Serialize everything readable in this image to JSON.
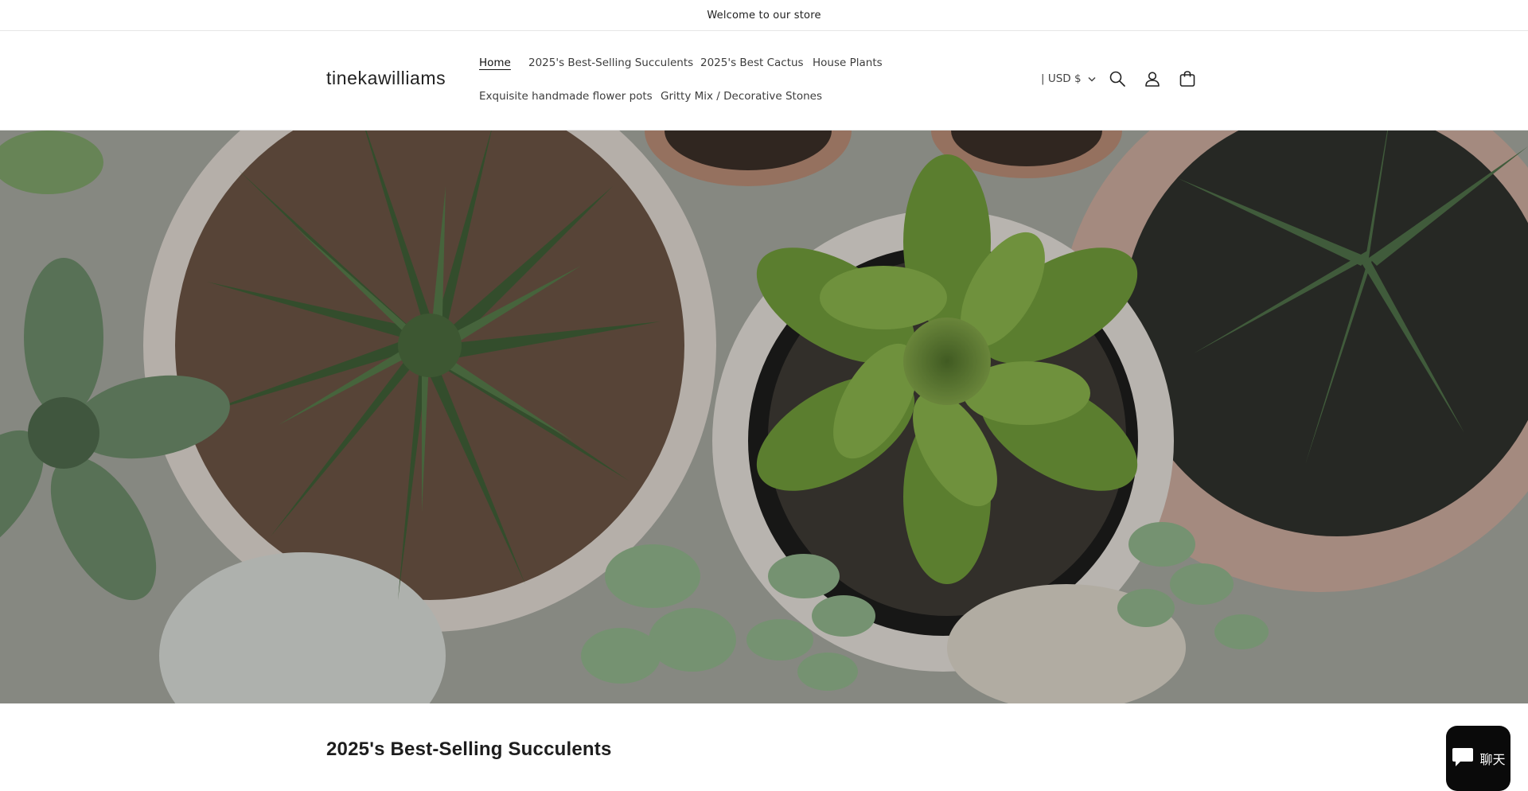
{
  "announcement": {
    "text": "Welcome to our store"
  },
  "header": {
    "logo": "tinekawilliams",
    "nav": [
      {
        "label": "Home",
        "active": true
      },
      {
        "label": "2025's Best-Selling Succulents",
        "active": false
      },
      {
        "label": "2025's Best Cactus",
        "active": false
      },
      {
        "label": "House Plants",
        "active": false
      },
      {
        "label": "Exquisite handmade flower pots",
        "active": false
      },
      {
        "label": "Gritty Mix / Decorative Stones",
        "active": false
      }
    ],
    "currency": "| USD $",
    "icons": [
      "search-icon",
      "account-icon",
      "cart-icon"
    ]
  },
  "hero": {
    "image": "overhead view of potted succulents"
  },
  "section": {
    "title": "2025's Best-Selling Succulents"
  },
  "chat": {
    "label": "聊天"
  },
  "colors": {
    "text": "#121212",
    "chat_bg": "#0a0a0a",
    "border": "#e6e6e6"
  }
}
